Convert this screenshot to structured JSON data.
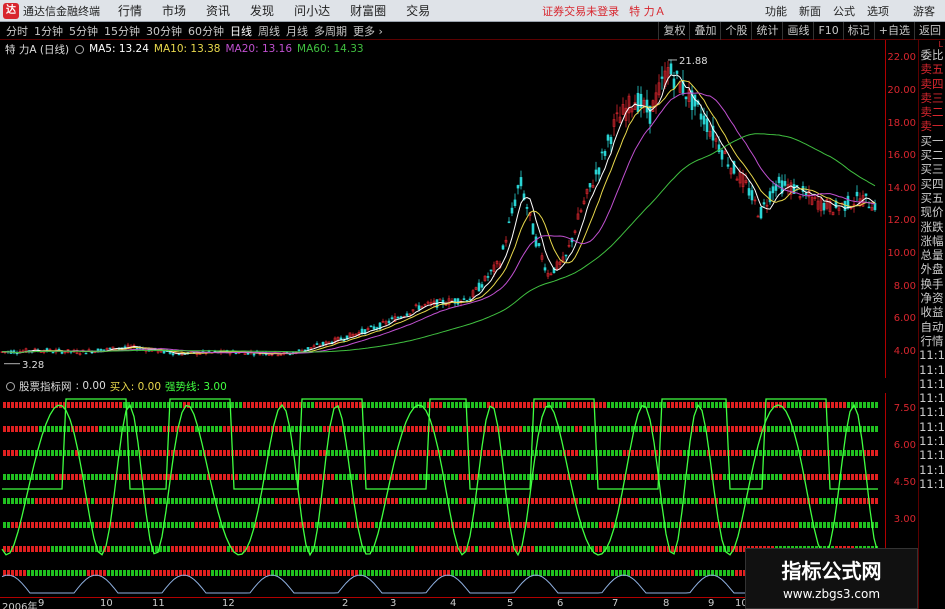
{
  "titlebar": {
    "app_title": "通达信金融终端",
    "menu": [
      "行情",
      "市场",
      "资讯",
      "发现",
      "问小达",
      "财富圈",
      "交易"
    ],
    "login_warning": "证券交易未登录",
    "stock_name": "特 力Ａ",
    "right_menu": [
      "功能",
      "新面",
      "公式",
      "选项"
    ],
    "user": "游客"
  },
  "periods": [
    "分时",
    "1分钟",
    "5分钟",
    "15分钟",
    "30分钟",
    "60分钟",
    "日线",
    "周线",
    "月线",
    "多周期",
    "更多 ›"
  ],
  "active_period": "日线",
  "right_tools": [
    "复权",
    "叠加",
    "个股",
    "统计",
    "画线",
    "F10",
    "标记",
    "+自选",
    "返回"
  ],
  "info": {
    "stock": "特 力A (日线)",
    "ma5": "MA5: 13.24",
    "ma10": "MA10: 13.38",
    "ma20": "MA20: 13.16",
    "ma60": "MA60: 14.33"
  },
  "price_ticks": [
    "22.00",
    "20.00",
    "18.00",
    "16.00",
    "14.00",
    "12.00",
    "10.00",
    "8.00",
    "6.00",
    "4.00"
  ],
  "annotations": {
    "high": "21.88",
    "low": "3.28"
  },
  "indicator": {
    "name": "股票指标网",
    "v1": ": 0.00",
    "v2": "买入: 0.00",
    "v3": "强势线: 3.00",
    "ticks": [
      "7.50",
      "6.00",
      "4.50",
      "3.00"
    ]
  },
  "right_panel": [
    "委比",
    "卖五",
    "卖四",
    "卖三",
    "卖二",
    "卖一",
    "买一",
    "买二",
    "买三",
    "买四",
    "买五",
    "现价",
    "涨跌",
    "涨幅",
    "总量",
    "外盘",
    "换手",
    "净资",
    "收益",
    "自动",
    "行情",
    "11:1",
    "11:1",
    "11:1",
    "11:1",
    "11:1",
    "11:1",
    "11:1",
    "11:1",
    "11:1",
    "11:1"
  ],
  "right_panel_tag": "L",
  "date_labels": [
    "2006年",
    "9",
    "10",
    "11",
    "12",
    "2",
    "3",
    "4",
    "5",
    "6",
    "7",
    "8",
    "9",
    "10"
  ],
  "watermark": {
    "line1": "指标公式网",
    "line2": "www.zbgs3.com"
  },
  "colors": {
    "up": "#d8262e",
    "ma5": "#ffffff",
    "ma10": "#e8d84c",
    "ma20": "#c050d0",
    "ma60": "#40c040",
    "ind": "#40ff40"
  }
}
